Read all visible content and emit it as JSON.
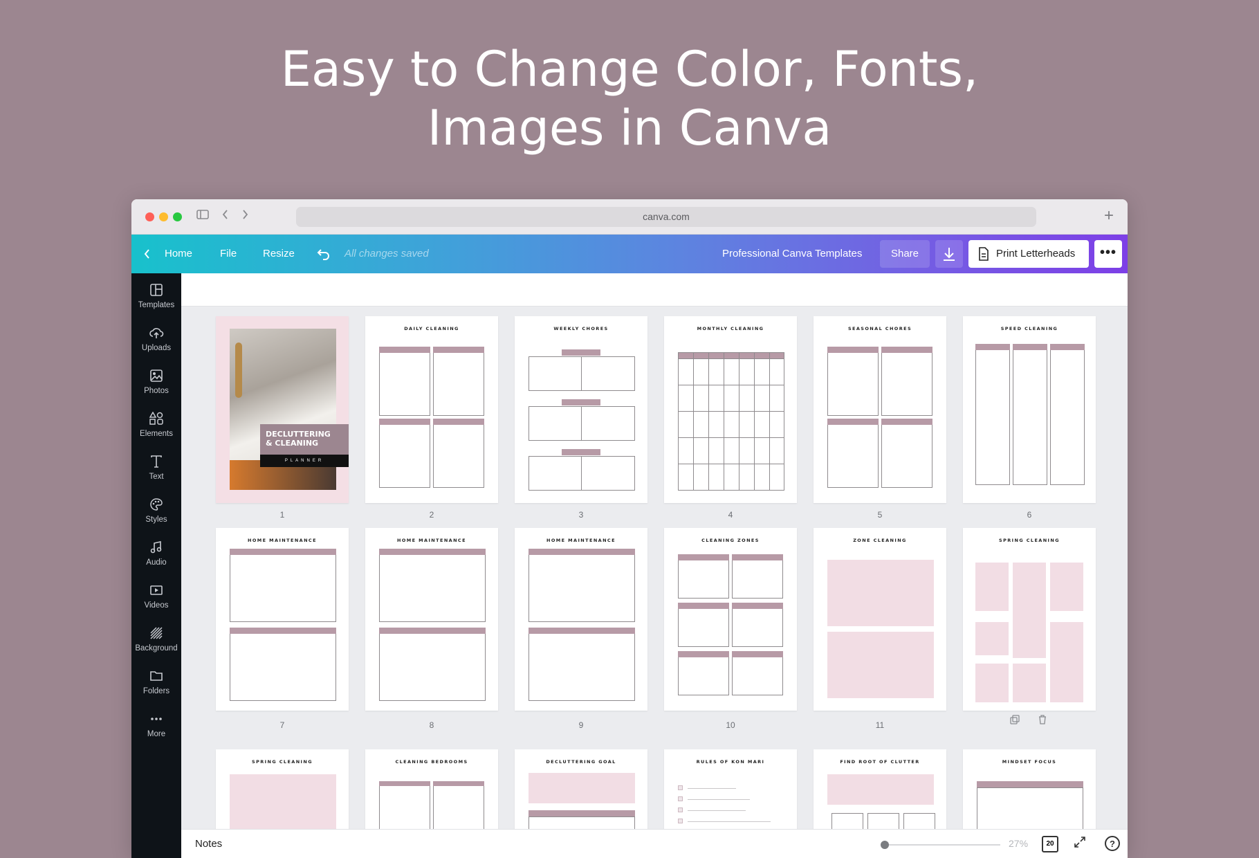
{
  "headline": {
    "line1": "Easy to Change Color, Fonts,",
    "line2": "Images in Canva"
  },
  "browser": {
    "url": "canva.com",
    "colors": {
      "red": "#fe5f57",
      "yellow": "#febc2e",
      "green": "#28c840"
    }
  },
  "topbar": {
    "back_icon": "chevron-left-icon",
    "home": "Home",
    "file": "File",
    "resize": "Resize",
    "undo_icon": "undo-icon",
    "saved": "All changes saved",
    "project_title": "Professional Canva Templates",
    "share": "Share",
    "download_icon": "download-icon",
    "print": "Print Letterheads",
    "more_icon": "more-horizontal-icon"
  },
  "sidebar": {
    "items": [
      {
        "label": "Templates",
        "icon": "templates-icon"
      },
      {
        "label": "Uploads",
        "icon": "upload-cloud-icon"
      },
      {
        "label": "Photos",
        "icon": "photos-icon"
      },
      {
        "label": "Elements",
        "icon": "elements-icon"
      },
      {
        "label": "Text",
        "icon": "text-icon"
      },
      {
        "label": "Styles",
        "icon": "palette-icon"
      },
      {
        "label": "Audio",
        "icon": "music-note-icon"
      },
      {
        "label": "Videos",
        "icon": "video-icon"
      },
      {
        "label": "Background",
        "icon": "background-pattern-icon"
      },
      {
        "label": "Folders",
        "icon": "folder-icon"
      },
      {
        "label": "More",
        "icon": "more-dots-icon"
      }
    ]
  },
  "cover": {
    "title_line1": "DECLUTTERING",
    "title_line2": "& CLEANING",
    "subtitle": "PLANNER"
  },
  "pages": [
    {
      "number": "1",
      "title": ""
    },
    {
      "number": "2",
      "title": "DAILY CLEANING"
    },
    {
      "number": "3",
      "title": "WEEKLY CHORES"
    },
    {
      "number": "4",
      "title": "MONTHLY CLEANING"
    },
    {
      "number": "5",
      "title": "SEASONAL CHORES"
    },
    {
      "number": "6",
      "title": "SPEED CLEANING"
    },
    {
      "number": "7",
      "title": "HOME MAINTENANCE"
    },
    {
      "number": "8",
      "title": "HOME MAINTENANCE"
    },
    {
      "number": "9",
      "title": "HOME MAINTENANCE"
    },
    {
      "number": "10",
      "title": "CLEANING ZONES"
    },
    {
      "number": "11",
      "title": "ZONE CLEANING"
    },
    {
      "number": "",
      "title": "SPRING CLEANING"
    },
    {
      "number": "",
      "title": "SPRING CLEANING"
    },
    {
      "number": "",
      "title": "CLEANING BEDROOMS"
    },
    {
      "number": "",
      "title": "DECLUTTERING GOAL"
    },
    {
      "number": "",
      "title": "RULES OF KON MARI"
    },
    {
      "number": "",
      "title": "FIND ROOT OF CLUTTER"
    },
    {
      "number": "",
      "title": "MINDSET FOCUS"
    }
  ],
  "page_actions": {
    "duplicate_icon": "duplicate-icon",
    "delete_icon": "trash-icon"
  },
  "bottombar": {
    "notes": "Notes",
    "zoom": "27%",
    "zoom_level": 0.27,
    "page_count": "20",
    "fullscreen_icon": "fullscreen-icon",
    "help": "?"
  }
}
